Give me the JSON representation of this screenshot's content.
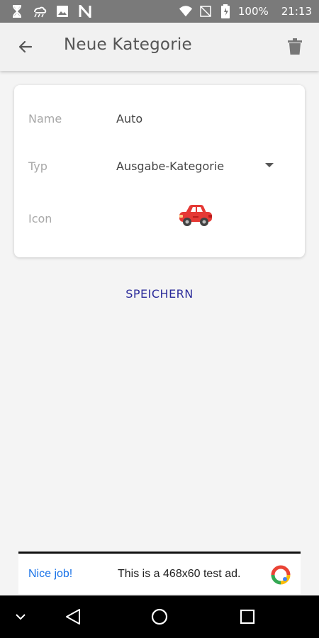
{
  "status_bar": {
    "battery": "100%",
    "time": "21:13",
    "icons": [
      "hourglass-icon",
      "rain-icon",
      "image-icon",
      "n-icon",
      "wifi-icon",
      "no-sim-icon",
      "battery-icon"
    ]
  },
  "app_bar": {
    "title": "Neue Kategorie",
    "back_icon": "arrow-back-icon",
    "delete_icon": "trash-icon"
  },
  "form": {
    "name_label": "Name",
    "name_value": "Auto",
    "type_label": "Typ",
    "type_value": "Ausgabe-Kategorie",
    "icon_label": "Icon",
    "icon_value": "car-icon",
    "icon_color": "#e53935"
  },
  "save_label": "SPEICHERN",
  "ad": {
    "left_text": "Nice job!",
    "text": "This is a 468x60 test ad."
  },
  "colors": {
    "accent": "#2b2b9a",
    "background": "#f4f4f4"
  }
}
